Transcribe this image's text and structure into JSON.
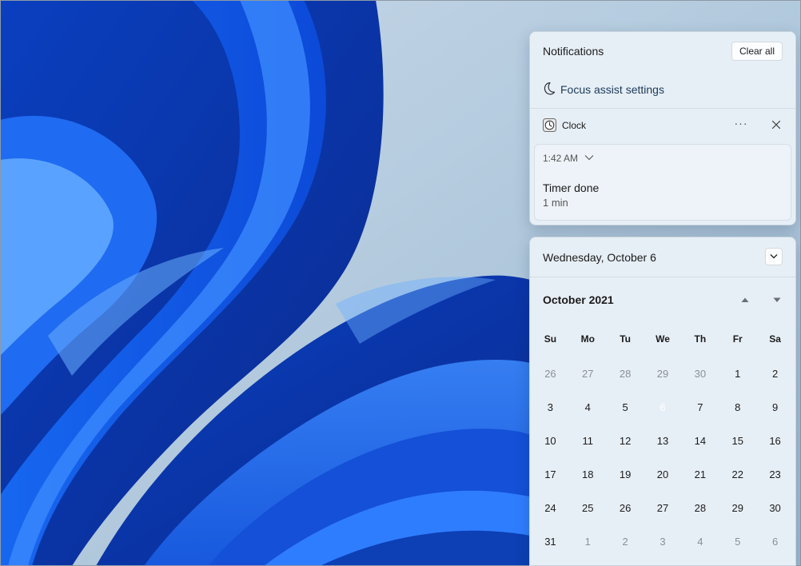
{
  "notifications": {
    "title": "Notifications",
    "clear_all": "Clear all",
    "focus_assist": "Focus assist settings",
    "app_name": "Clock",
    "more_label": "···",
    "toast": {
      "time": "1:42 AM",
      "title": "Timer done",
      "body": "1 min"
    }
  },
  "calendar": {
    "date_header": "Wednesday, October 6",
    "month_title": "October 2021",
    "weekdays": [
      "Su",
      "Mo",
      "Tu",
      "We",
      "Th",
      "Fr",
      "Sa"
    ],
    "days": [
      {
        "n": "26",
        "other": true
      },
      {
        "n": "27",
        "other": true
      },
      {
        "n": "28",
        "other": true
      },
      {
        "n": "29",
        "other": true
      },
      {
        "n": "30",
        "other": true
      },
      {
        "n": "1"
      },
      {
        "n": "2"
      },
      {
        "n": "3"
      },
      {
        "n": "4"
      },
      {
        "n": "5"
      },
      {
        "n": "6",
        "today": true
      },
      {
        "n": "7"
      },
      {
        "n": "8"
      },
      {
        "n": "9"
      },
      {
        "n": "10"
      },
      {
        "n": "11"
      },
      {
        "n": "12"
      },
      {
        "n": "13"
      },
      {
        "n": "14"
      },
      {
        "n": "15"
      },
      {
        "n": "16"
      },
      {
        "n": "17"
      },
      {
        "n": "18"
      },
      {
        "n": "19"
      },
      {
        "n": "20"
      },
      {
        "n": "21"
      },
      {
        "n": "22"
      },
      {
        "n": "23"
      },
      {
        "n": "24"
      },
      {
        "n": "25"
      },
      {
        "n": "26"
      },
      {
        "n": "27"
      },
      {
        "n": "28"
      },
      {
        "n": "29"
      },
      {
        "n": "30"
      },
      {
        "n": "31"
      },
      {
        "n": "1",
        "other": true
      },
      {
        "n": "2",
        "other": true
      },
      {
        "n": "3",
        "other": true
      },
      {
        "n": "4",
        "other": true
      },
      {
        "n": "5",
        "other": true
      },
      {
        "n": "6",
        "other": true
      }
    ]
  },
  "icons": {
    "focus": "moon-icon",
    "app": "clock-app-icon",
    "close": "close-icon",
    "expand": "chevron-down-icon",
    "prev_month": "triangle-up-icon",
    "next_month": "triangle-down-icon"
  },
  "colors": {
    "accent": "#0061b0",
    "panel": "#e7eff6"
  }
}
